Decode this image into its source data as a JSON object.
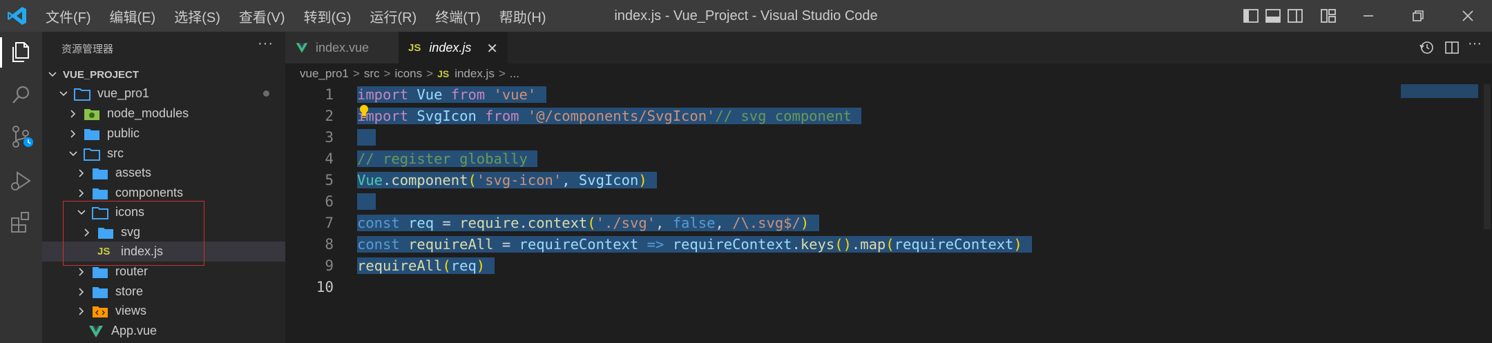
{
  "window": {
    "title": "index.js - Vue_Project - Visual Studio Code",
    "menu": [
      "文件(F)",
      "编辑(E)",
      "选择(S)",
      "查看(V)",
      "转到(G)",
      "运行(R)",
      "终端(T)",
      "帮助(H)"
    ]
  },
  "sidebar": {
    "title": "资源管理器",
    "more": "···",
    "project": "VUE_PROJECT",
    "tree": [
      {
        "label": "vue_pro1",
        "type": "folder",
        "open": true
      },
      {
        "label": "node_modules",
        "type": "folder-node",
        "open": false
      },
      {
        "label": "public",
        "type": "folder",
        "open": false
      },
      {
        "label": "src",
        "type": "folder",
        "open": true
      },
      {
        "label": "assets",
        "type": "folder",
        "open": false
      },
      {
        "label": "components",
        "type": "folder",
        "open": false
      },
      {
        "label": "icons",
        "type": "folder",
        "open": true
      },
      {
        "label": "svg",
        "type": "folder",
        "open": false
      },
      {
        "label": "index.js",
        "type": "js",
        "icon_text": "JS"
      },
      {
        "label": "router",
        "type": "folder",
        "open": false
      },
      {
        "label": "store",
        "type": "folder",
        "open": false
      },
      {
        "label": "views",
        "type": "folder-views",
        "open": false
      },
      {
        "label": "App.vue",
        "type": "vue"
      }
    ]
  },
  "tabs": [
    {
      "label": "index.vue",
      "icon": "vue-icon"
    },
    {
      "label": "index.js",
      "icon_text": "JS",
      "close": "✕"
    }
  ],
  "breadcrumb": [
    "vue_pro1",
    "src",
    "icons",
    "index.js",
    "..."
  ],
  "breadcrumb_js": "JS",
  "breadcrumb_sep": ">",
  "editor": {
    "line_numbers": [
      "1",
      "2",
      "3",
      "4",
      "5",
      "6",
      "7",
      "8",
      "9",
      "10"
    ]
  },
  "colors": {
    "selection": "#264f78",
    "accent": "#0098ff",
    "folder": "#42a5f5",
    "js": "#cbcb41",
    "vue": "#41b883",
    "highlight_box": "#d0312d"
  }
}
